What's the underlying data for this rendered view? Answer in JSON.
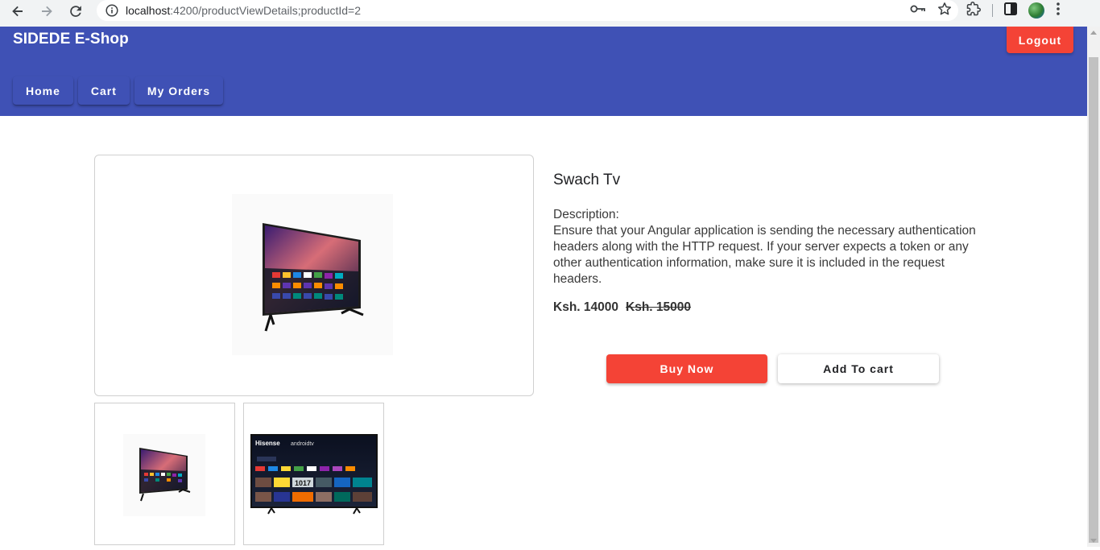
{
  "browser": {
    "url_host": "localhost",
    "url_path": ":4200/productViewDetails;productId=2"
  },
  "app": {
    "brand": "SIDEDE E-Shop",
    "logout_label": "Logout",
    "nav": [
      {
        "label": "Home"
      },
      {
        "label": "Cart"
      },
      {
        "label": "My Orders"
      }
    ],
    "accent_color": "#3f51b5",
    "warn_color": "#f44336"
  },
  "product": {
    "name": "Swach Tv",
    "description_label": "Description:",
    "description": "Ensure that your Angular application is sending the necessary authentication headers along with the HTTP request. If your server expects a token or any other authentication information, make sure it is included in the request headers.",
    "price": "Ksh. 14000",
    "old_price": "Ksh. 15000",
    "buy_now_label": "Buy Now",
    "add_to_cart_label": "Add To cart",
    "thumb2_tv": {
      "brand": "Hisense",
      "platform": "androidtv",
      "tile_text": "1017"
    }
  }
}
